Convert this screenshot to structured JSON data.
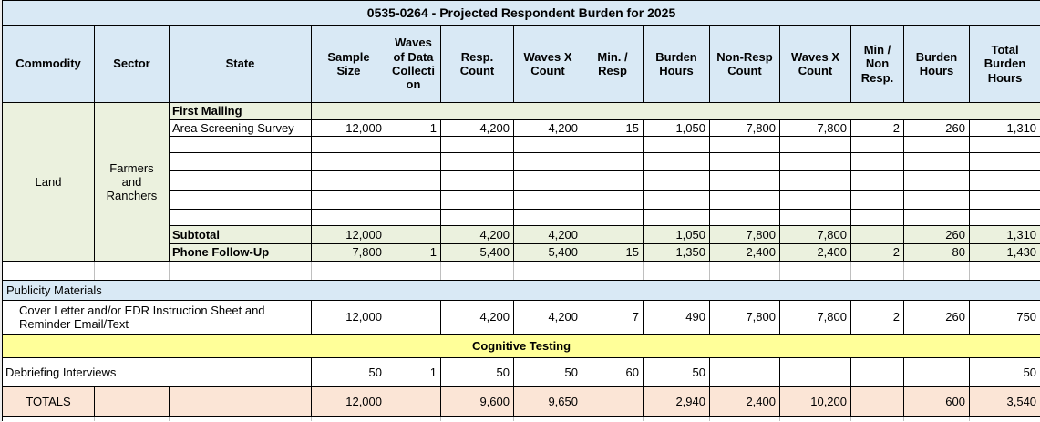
{
  "colors": {
    "header_blue": "#D9E9F5",
    "band_green": "#EBF1DE",
    "band_yellow": "#FFFF99",
    "totals_peach": "#FBE5D6",
    "grid_gray": "#BFBFBF"
  },
  "chart_data": {
    "type": "table",
    "title": "0535-0264 - Projected Respondent Burden for 2025",
    "columns": [
      "Commodity",
      "Sector",
      "State",
      "Sample Size",
      "Waves of Data Collection",
      "Resp. Count",
      "Waves X Count",
      "Min. / Resp",
      "Burden Hours",
      "Non-Resp Count",
      "Waves X Count",
      "Min / Non Resp.",
      "Burden Hours",
      "Total Burden Hours"
    ],
    "commodity": "Land",
    "sector": "Farmers and Ranchers",
    "section_bands": {
      "first_mailing": "First Mailing",
      "publicity": "Publicity Materials",
      "cognitive": "Cognitive Testing"
    },
    "rows": {
      "area_screening": {
        "label": "Area Screening Survey",
        "values": [
          "12,000",
          "1",
          "4,200",
          "4,200",
          "15",
          "1,050",
          "7,800",
          "7,800",
          "2",
          "260",
          "1,310"
        ]
      },
      "subtotal": {
        "label": "Subtotal",
        "values": [
          "12,000",
          "",
          "4,200",
          "4,200",
          "",
          "1,050",
          "7,800",
          "7,800",
          "",
          "260",
          "1,310"
        ]
      },
      "phone_follow_up": {
        "label": "Phone Follow-Up",
        "values": [
          "7,800",
          "1",
          "5,400",
          "5,400",
          "15",
          "1,350",
          "2,400",
          "2,400",
          "2",
          "80",
          "1,430"
        ]
      },
      "cover_letter": {
        "label": "Cover Letter and/or EDR Instruction Sheet and Reminder Email/Text",
        "values": [
          "12,000",
          "",
          "4,200",
          "4,200",
          "7",
          "490",
          "7,800",
          "7,800",
          "2",
          "260",
          "750"
        ]
      },
      "debriefing": {
        "label": "Debriefing Interviews",
        "values": [
          "50",
          "1",
          "50",
          "50",
          "60",
          "50",
          "",
          "",
          "",
          "",
          "50"
        ]
      },
      "totals": {
        "label": "TOTALS",
        "values": [
          "12,000",
          "",
          "9,600",
          "9,650",
          "",
          "2,940",
          "2,400",
          "10,200",
          "",
          "600",
          "3,540"
        ]
      }
    },
    "blank_11": [
      "",
      "",
      "",
      "",
      "",
      "",
      "",
      "",
      "",
      "",
      ""
    ],
    "blank_14": [
      "",
      "",
      "",
      "",
      "",
      "",
      "",
      "",
      "",
      "",
      "",
      "",
      "",
      ""
    ]
  }
}
